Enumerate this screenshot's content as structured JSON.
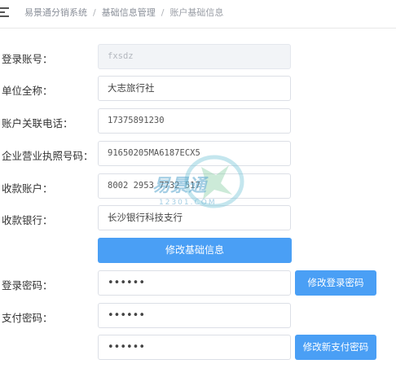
{
  "breadcrumb": {
    "items": [
      "易景通分销系统",
      "基础信息管理",
      "账户基础信息"
    ]
  },
  "form": {
    "account": {
      "label": "登录账号：",
      "value": "fxsdz"
    },
    "company_name": {
      "label": "单位全称：",
      "value": "大志旅行社"
    },
    "phone": {
      "label": "账户关联电话：",
      "value": "17375891230"
    },
    "license": {
      "label": "企业营业执照号码：",
      "value": "91650205MA6187ECX5"
    },
    "bank_account": {
      "label": "收款账户：",
      "value": "8002 2953 7732 517"
    },
    "bank_name": {
      "label": "收款银行：",
      "value": "长沙银行科技支行"
    },
    "save_basic_button": "修改基础信息",
    "login_password": {
      "label": "登录密码：",
      "value": "••••••",
      "button": "修改登录密码"
    },
    "pay_password": {
      "label": "支付密码：",
      "value": "••••••"
    },
    "new_pay_password": {
      "value": "••••••",
      "button": "修改新支付密码"
    }
  },
  "watermark": {
    "brand": "易景通",
    "domain": "12301.COM"
  },
  "colors": {
    "primary": "#4a9ff5",
    "disabled_bg": "#f2f4f7",
    "border": "#dcdfe6"
  }
}
